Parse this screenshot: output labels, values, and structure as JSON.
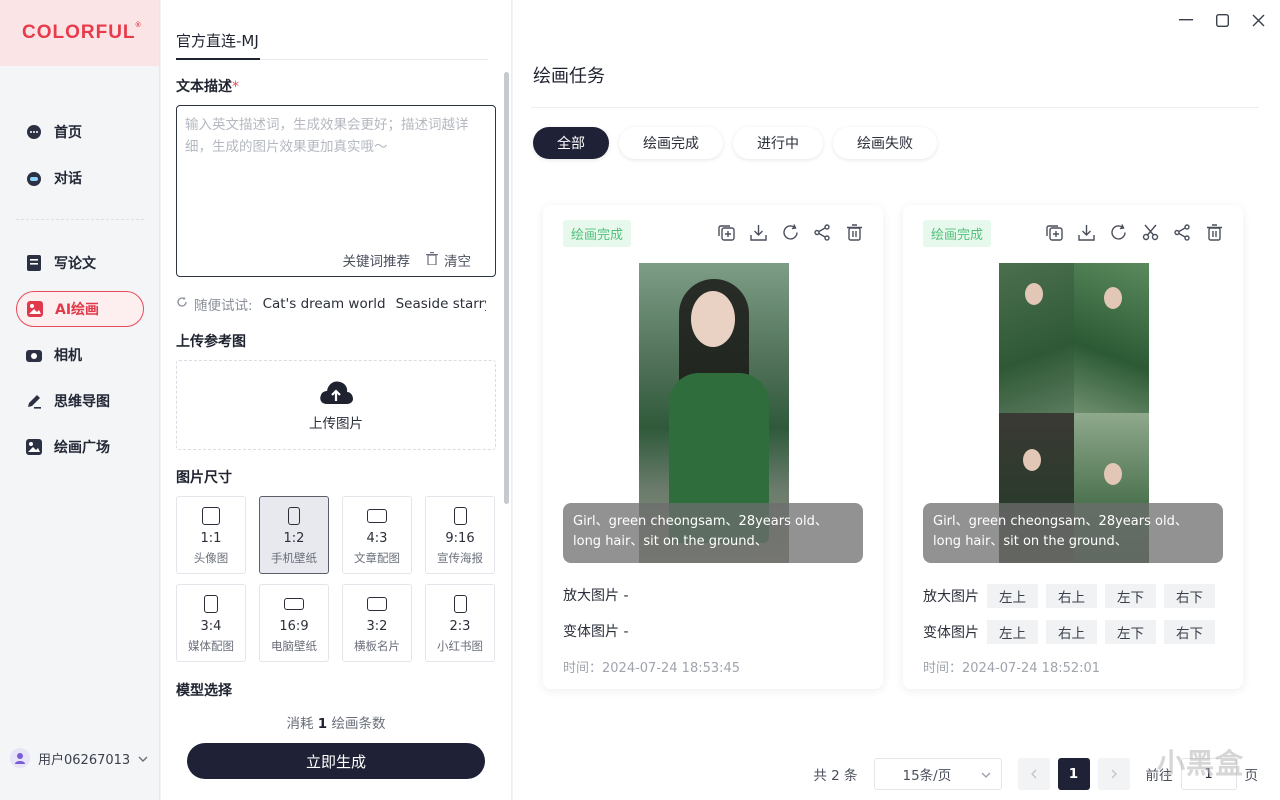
{
  "brand": {
    "logo": "COLORFUL",
    "reg": "®"
  },
  "nav": {
    "items": [
      {
        "label": "首页",
        "icon": "chat-bubble-icon"
      },
      {
        "label": "对话",
        "icon": "robot-icon"
      },
      {
        "label": "写论文",
        "icon": "document-icon"
      },
      {
        "label": "AI绘画",
        "icon": "image-icon",
        "active": true
      },
      {
        "label": "相机",
        "icon": "camera-icon"
      },
      {
        "label": "思维导图",
        "icon": "pen-icon"
      },
      {
        "label": "绘画广场",
        "icon": "gallery-icon"
      }
    ],
    "user": "用户06267013"
  },
  "form": {
    "tab": "官方直连-MJ",
    "prompt_label": "文本描述",
    "prompt_required": "*",
    "prompt_placeholder": "输入英文描述词，生成效果会更好；描述词越详细，生成的图片效果更加真实哦～",
    "keyword_btn": "关键词推荐",
    "clear_btn": "清空",
    "try_label": "随便试试:",
    "try_items": [
      "Cat's dream world",
      "Seaside starry s"
    ],
    "upload_label": "上传参考图",
    "upload_text": "上传图片",
    "size_label": "图片尺寸",
    "sizes": [
      {
        "ratio": "1:1",
        "desc": "头像图"
      },
      {
        "ratio": "1:2",
        "desc": "手机壁纸",
        "active": true
      },
      {
        "ratio": "4:3",
        "desc": "文章配图"
      },
      {
        "ratio": "9:16",
        "desc": "宣传海报"
      },
      {
        "ratio": "3:4",
        "desc": "媒体配图"
      },
      {
        "ratio": "16:9",
        "desc": "电脑壁纸"
      },
      {
        "ratio": "3:2",
        "desc": "横板名片"
      },
      {
        "ratio": "2:3",
        "desc": "小红书图"
      }
    ],
    "model_label": "模型选择",
    "cost_prefix": "消耗",
    "cost_value": "1",
    "cost_suffix": "绘画条数",
    "generate": "立即生成"
  },
  "main": {
    "title": "绘画任务",
    "filters": [
      "全部",
      "绘画完成",
      "进行中",
      "绘画失败"
    ],
    "active_filter": 0,
    "cards": [
      {
        "status": "绘画完成",
        "prompt": "Girl、green cheongsam、28years old、long hair、sit on the ground、",
        "upscale_label": "放大图片 -",
        "variant_label": "变体图片 -",
        "time": "时间：2024-07-24 18:53:45",
        "tools": [
          "copy-icon",
          "download-icon",
          "refresh-icon",
          "share-icon",
          "trash-icon"
        ]
      },
      {
        "status": "绘画完成",
        "prompt": "Girl、green cheongsam、28years old、long hair、sit on the ground、",
        "upscale_label": "放大图片",
        "variant_label": "变体图片",
        "positions": [
          "左上",
          "右上",
          "左下",
          "右下"
        ],
        "time": "时间：2024-07-24 18:52:01",
        "tools": [
          "copy-icon",
          "download-icon",
          "refresh-icon",
          "scissors-icon",
          "share-icon",
          "trash-icon"
        ]
      }
    ],
    "pager": {
      "total": "共 2 条",
      "per_page": "15条/页",
      "current": "1",
      "goto": "前往",
      "goto_value": "1",
      "page_unit": "页"
    }
  },
  "watermark": "小黑盒",
  "colors": {
    "brand": "#e83a4a",
    "dark": "#1f2236",
    "success": "#52c07a"
  }
}
